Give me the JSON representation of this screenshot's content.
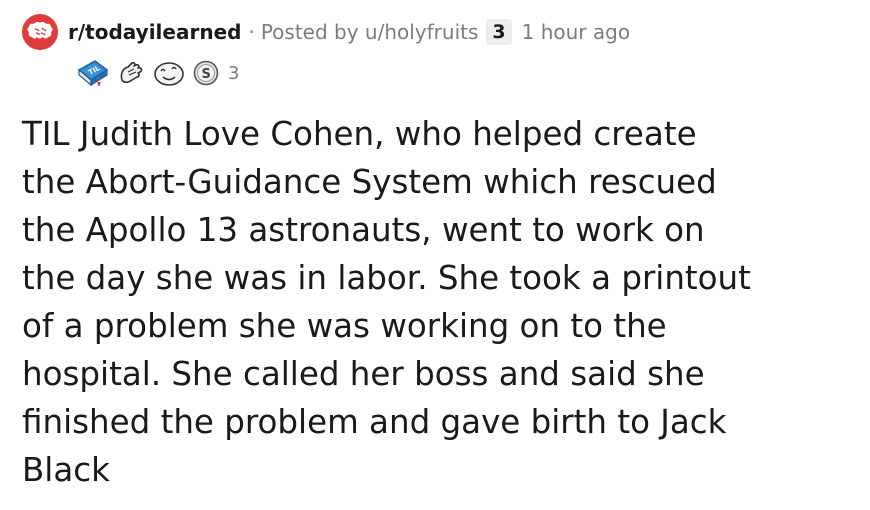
{
  "post": {
    "subreddit": "r/todayilearned",
    "separator": "·",
    "posted_by": "Posted by u/holyfruits",
    "user_karma_badge": "3",
    "time_ago": "1 hour ago",
    "awards": [
      {
        "icon": "til-book-icon"
      },
      {
        "icon": "dabbing-hand-icon"
      },
      {
        "icon": "silly-face-icon"
      },
      {
        "icon": "silver-coin-icon"
      }
    ],
    "award_count": "3",
    "title": "TIL Judith Love Cohen, who helped create\nthe Abort-Guidance System which rescued\nthe Apollo 13 astronauts, went to work on\nthe day she was in labor. She took a printout\nof a problem she was working on to the\nhospital. She called her boss and said she\nfinished the problem and gave birth to Jack\nBlack"
  },
  "colors": {
    "subreddit_icon": "#e03a3a",
    "award_book": "#3a8fd9",
    "meta_text": "#7c7c7c",
    "title_text": "#1a1a1b"
  }
}
